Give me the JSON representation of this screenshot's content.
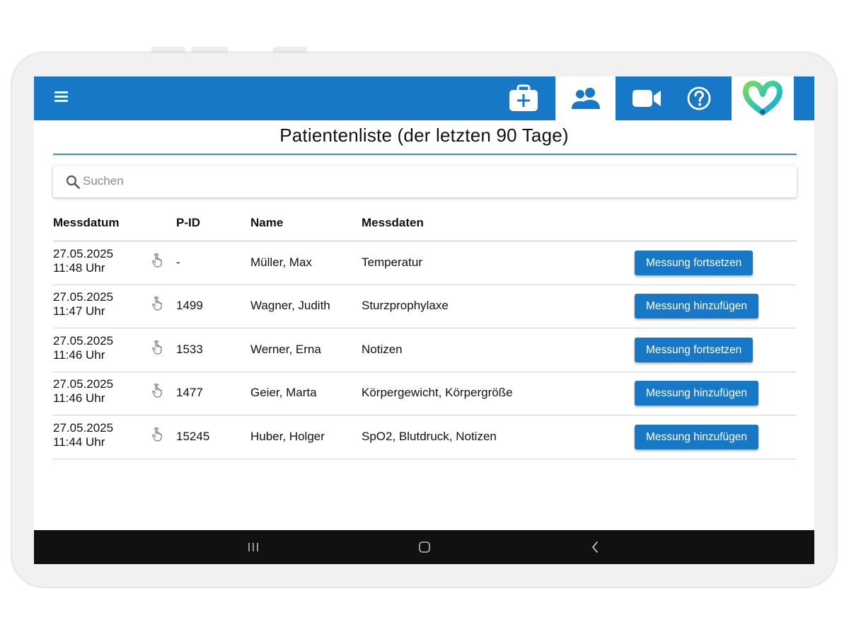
{
  "colors": {
    "primary": "#1878c8",
    "navbar": "#111111",
    "frame": "#f1f1f1"
  },
  "appbar": {
    "icons": [
      "menu-icon",
      "medical-kit-icon",
      "patients-icon",
      "video-camera-icon",
      "help-icon",
      "heart-logo-icon"
    ],
    "active": "patients"
  },
  "page": {
    "title": "Patientenliste (der letzten 90 Tage)"
  },
  "search": {
    "placeholder": "Suchen",
    "value": ""
  },
  "table": {
    "headers": {
      "date": "Messdatum",
      "pid": "P-ID",
      "name": "Name",
      "data": "Messdaten"
    },
    "rows": [
      {
        "date": "27.05.2025",
        "time": "11:48 Uhr",
        "pid": "-",
        "name": "Müller, Max",
        "data": "Temperatur",
        "action": "Messung fortsetzen"
      },
      {
        "date": "27.05.2025",
        "time": "11:47 Uhr",
        "pid": "1499",
        "name": "Wagner, Judith",
        "data": "Sturzprophylaxe",
        "action": "Messung hinzufügen"
      },
      {
        "date": "27.05.2025",
        "time": "11:46 Uhr",
        "pid": "1533",
        "name": "Werner, Erna",
        "data": "Notizen",
        "action": "Messung fortsetzen"
      },
      {
        "date": "27.05.2025",
        "time": "11:46 Uhr",
        "pid": "1477",
        "name": "Geier, Marta",
        "data": "Körpergewicht, Körpergröße",
        "action": "Messung hinzufügen"
      },
      {
        "date": "27.05.2025",
        "time": "11:44 Uhr",
        "pid": "15245",
        "name": "Huber, Holger",
        "data": "SpO2, Blutdruck, Notizen",
        "action": "Messung hinzufügen"
      }
    ]
  },
  "system_nav": {
    "icons": [
      "recent-apps-icon",
      "home-icon",
      "back-icon"
    ]
  }
}
